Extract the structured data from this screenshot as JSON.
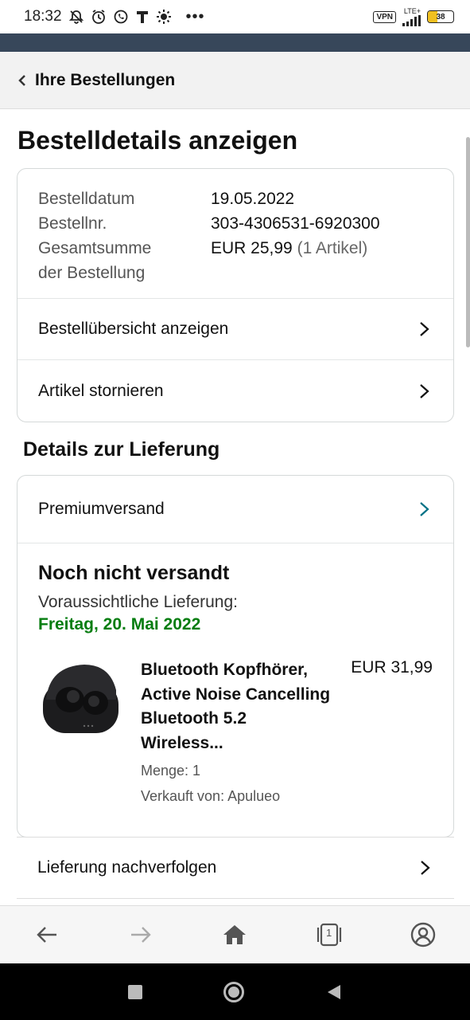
{
  "status_bar": {
    "time": "18:32",
    "icons": [
      "mute-bell-icon",
      "alarm-icon",
      "whatsapp-icon",
      "t-icon",
      "brightness-icon",
      "more-dots-icon"
    ],
    "vpn": "VPN",
    "network": "LTE+",
    "battery": "38",
    "battery_level": 0.38
  },
  "header": {
    "back_label": "Ihre Bestellungen"
  },
  "page_title": "Bestelldetails anzeigen",
  "order": {
    "date_label": "Bestelldatum",
    "date_value": "19.05.2022",
    "number_label": "Bestellnr.",
    "number_value": "303-4306531-6920300",
    "total_label_line1": "Gesamtsumme",
    "total_label_line2": "der Bestellung",
    "total_value": "EUR 25,99",
    "total_items": "(1 Artikel)",
    "summary_link": "Bestellübersicht anzeigen",
    "cancel_link": "Artikel stornieren"
  },
  "delivery": {
    "section_title": "Details zur Lieferung",
    "shipping_type": "Premiumversand",
    "status": "Noch nicht versandt",
    "expected_label": "Voraussichtliche Lieferung:",
    "expected_date": "Freitag, 20. Mai 2022",
    "item": {
      "title": "Bluetooth Kopfhörer, Active Noise Cancelling Bluetooth 5.2 Wireless...",
      "price": "EUR 31,99",
      "quantity": "Menge: 1",
      "seller": "Verkauft von: Apulueo"
    },
    "track_link": "Lieferung nachverfolgen"
  },
  "toolbar": {
    "tab_count": "1",
    "icons": [
      "back-arrow-icon",
      "forward-arrow-icon",
      "home-icon",
      "tabs-icon",
      "account-icon"
    ]
  },
  "colors": {
    "accent_dark": "#37475a",
    "delivery_green": "#067d10",
    "link_teal": "#007185"
  }
}
